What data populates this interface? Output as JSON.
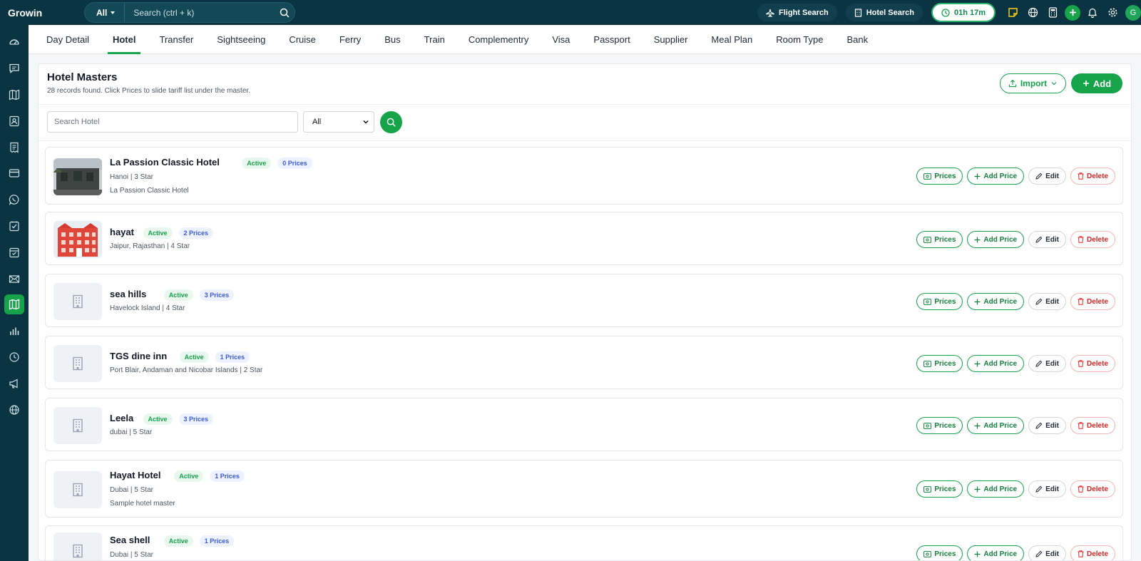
{
  "app": {
    "brand": "Growin"
  },
  "topbar": {
    "search_scope": "All",
    "search_placeholder": "Search (ctrl + k)",
    "flight_search": "Flight Search",
    "hotel_search": "Hotel Search",
    "timer": "01h 17m",
    "avatar_initial": "G",
    "icons": [
      "sticky-note-icon",
      "globe-icon",
      "calculator-icon",
      "plus-icon",
      "bell-icon",
      "gear-icon"
    ]
  },
  "sidebar": {
    "items": [
      "dashboard-icon",
      "chat-icon",
      "map-icon",
      "contacts-icon",
      "invoice-icon",
      "card-icon",
      "whatsapp-icon",
      "task-icon",
      "calendar-icon",
      "mail-icon",
      "masters-icon",
      "chart-icon",
      "clock-icon",
      "megaphone-icon",
      "globe-icon"
    ],
    "active_index": 10
  },
  "tabs": [
    {
      "label": "Day Detail"
    },
    {
      "label": "Hotel",
      "active": true
    },
    {
      "label": "Transfer"
    },
    {
      "label": "Sightseeing"
    },
    {
      "label": "Cruise"
    },
    {
      "label": "Ferry"
    },
    {
      "label": "Bus"
    },
    {
      "label": "Train"
    },
    {
      "label": "Complementry"
    },
    {
      "label": "Visa"
    },
    {
      "label": "Passport"
    },
    {
      "label": "Supplier"
    },
    {
      "label": "Meal Plan"
    },
    {
      "label": "Room Type"
    },
    {
      "label": "Bank"
    }
  ],
  "page": {
    "title": "Hotel Masters",
    "subtitle": "28 records found. Click Prices to slide tariff list under the master.",
    "import_label": "Import",
    "add_label": "Add",
    "search_placeholder": "Search Hotel",
    "filter_value": "All"
  },
  "actions": {
    "prices": "Prices",
    "add_price": "Add Price",
    "edit": "Edit",
    "delete": "Delete"
  },
  "hotels": [
    {
      "name": "La Passion Classic Hotel",
      "status": "Active",
      "prices": "0 Prices",
      "meta": "Hanoi | 3 Star",
      "desc": "La Passion Classic Hotel",
      "image": "photo-dark"
    },
    {
      "name": "hayat",
      "status": "Active",
      "prices": "2 Prices",
      "meta": "Jaipur, Rajasthan | 4 Star",
      "desc": "",
      "image": "photo-red"
    },
    {
      "name": "sea hills",
      "status": "Active",
      "prices": "3 Prices",
      "meta": "Havelock Island | 4 Star",
      "desc": "",
      "image": "placeholder"
    },
    {
      "name": "TGS dine inn",
      "status": "Active",
      "prices": "1 Prices",
      "meta": "Port Blair, Andaman and Nicobar Islands | 2 Star",
      "desc": "",
      "image": "placeholder"
    },
    {
      "name": "Leela",
      "status": "Active",
      "prices": "3 Prices",
      "meta": "dubai | 5 Star",
      "desc": "",
      "image": "placeholder"
    },
    {
      "name": "Hayat Hotel",
      "status": "Active",
      "prices": "1 Prices",
      "meta": "Dubai | 5 Star",
      "desc": "Sample hotel master",
      "image": "placeholder"
    },
    {
      "name": "Sea shell",
      "status": "Active",
      "prices": "1 Prices",
      "meta": "Dubai | 5 Star",
      "desc": "",
      "image": "placeholder"
    }
  ]
}
